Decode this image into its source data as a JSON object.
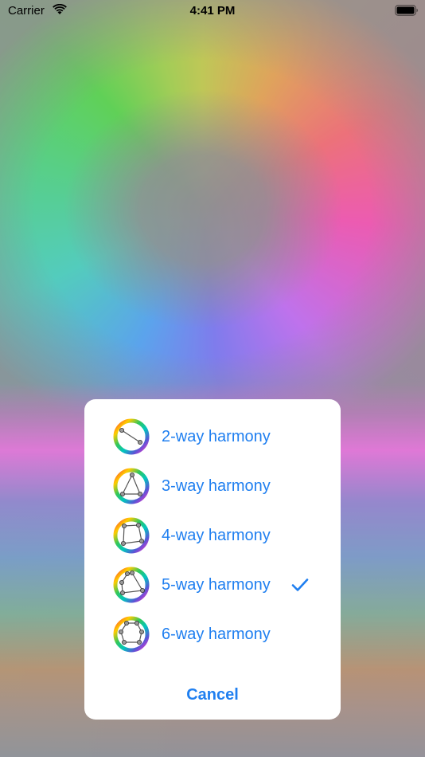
{
  "status_bar": {
    "carrier": "Carrier",
    "time": "4:41 PM",
    "icons": [
      "wifi-icon",
      "battery-icon"
    ]
  },
  "action_sheet": {
    "options": [
      {
        "label": "2-way harmony",
        "icon": "color-wheel-2-way-icon",
        "selected": false
      },
      {
        "label": "3-way harmony",
        "icon": "color-wheel-3-way-icon",
        "selected": false
      },
      {
        "label": "4-way harmony",
        "icon": "color-wheel-4-way-icon",
        "selected": false
      },
      {
        "label": "5-way harmony",
        "icon": "color-wheel-5-way-icon",
        "selected": true
      },
      {
        "label": "6-way harmony",
        "icon": "color-wheel-6-way-icon",
        "selected": false
      }
    ],
    "cancel_label": "Cancel"
  },
  "colors": {
    "accent": "#1f7ff0",
    "sheet_background": "#ffffff"
  }
}
